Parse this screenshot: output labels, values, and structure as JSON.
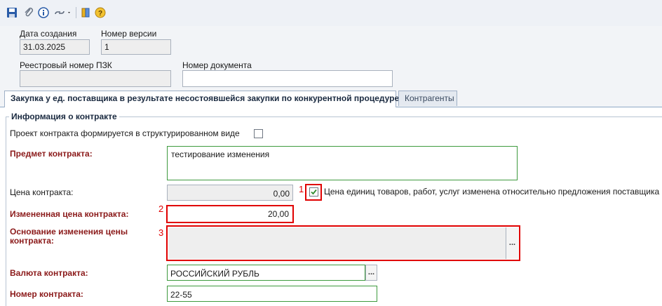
{
  "toolbar": {
    "icons": [
      "save-icon",
      "attach-icon",
      "info-icon",
      "link-dropdown-icon",
      "exit-icon",
      "help-icon"
    ]
  },
  "header": {
    "created_label": "Дата создания",
    "created_value": "31.03.2025",
    "version_label": "Номер версии",
    "version_value": "1",
    "registry_label": "Реестровый номер ПЗК",
    "registry_value": "",
    "docnum_label": "Номер документа",
    "docnum_value": ""
  },
  "tabs": [
    {
      "label": "Закупка у ед. поставщика в результате несостоявшейся закупки по конкурентной процедуре",
      "active": true
    },
    {
      "label": "Контрагенты",
      "active": false
    }
  ],
  "contract": {
    "group_title": "Информация о контракте",
    "structured_label": "Проект контракта формируется в структурированном виде",
    "structured_checked": false,
    "subject_label": "Предмет контракта:",
    "subject_value": "тестирование изменения",
    "price_label": "Цена контракта:",
    "price_value": "0,00",
    "unit_price_label": "Цена единиц товаров, работ, услуг изменена относительно предложения поставщика",
    "unit_price_checked": true,
    "changed_price_label": "Измененная цена контракта:",
    "changed_price_value": "20,00",
    "reason_label": "Основание изменения цены контракта:",
    "reason_value": "",
    "currency_label": "Валюта контракта:",
    "currency_value": "РОССИЙСКИЙ РУБЛЬ",
    "number_label": "Номер контракта:",
    "number_value": "22-55",
    "ellipsis": "..."
  },
  "annotations": {
    "mark1": "1",
    "mark2": "2",
    "mark3": "3",
    "color": "#e00000"
  }
}
